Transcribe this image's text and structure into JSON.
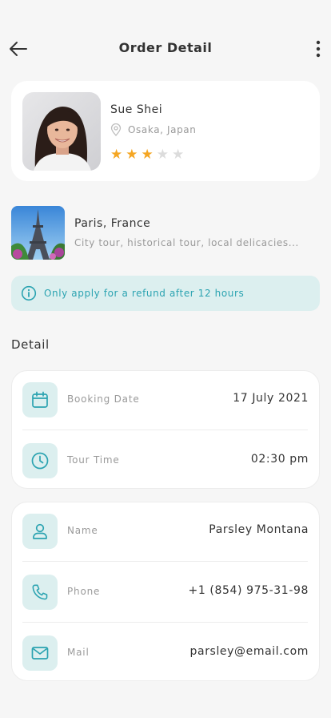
{
  "header": {
    "title": "Order Detail",
    "back_icon": "arrow-left-icon",
    "more_icon": "more-vertical-icon"
  },
  "profile": {
    "name": "Sue Shei",
    "location": "Osaka, Japan",
    "rating": 3,
    "rating_max": 5,
    "star_color": "#f5a623"
  },
  "tour": {
    "title": "Paris, France",
    "subtitle": "City tour, historical tour, local delicacies..."
  },
  "notice": {
    "text": "Only apply for a refund after 12 hours",
    "color": "#2ba3b1"
  },
  "detail": {
    "section_title": "Detail",
    "booking": [
      {
        "icon": "calendar-icon",
        "label": "Booking Date",
        "value": "17 July 2021"
      },
      {
        "icon": "clock-icon",
        "label": "Tour Time",
        "value": "02:30 pm"
      }
    ],
    "contact": [
      {
        "icon": "user-icon",
        "label": "Name",
        "value": "Parsley Montana"
      },
      {
        "icon": "phone-icon",
        "label": "Phone",
        "value": "+1 (854) 975-31-98"
      },
      {
        "icon": "mail-icon",
        "label": "Mail",
        "value": "parsley@email.com"
      }
    ]
  },
  "colors": {
    "accent": "#2ba3b1",
    "accent_bg": "#dcefef",
    "background": "#f6f6f6"
  }
}
